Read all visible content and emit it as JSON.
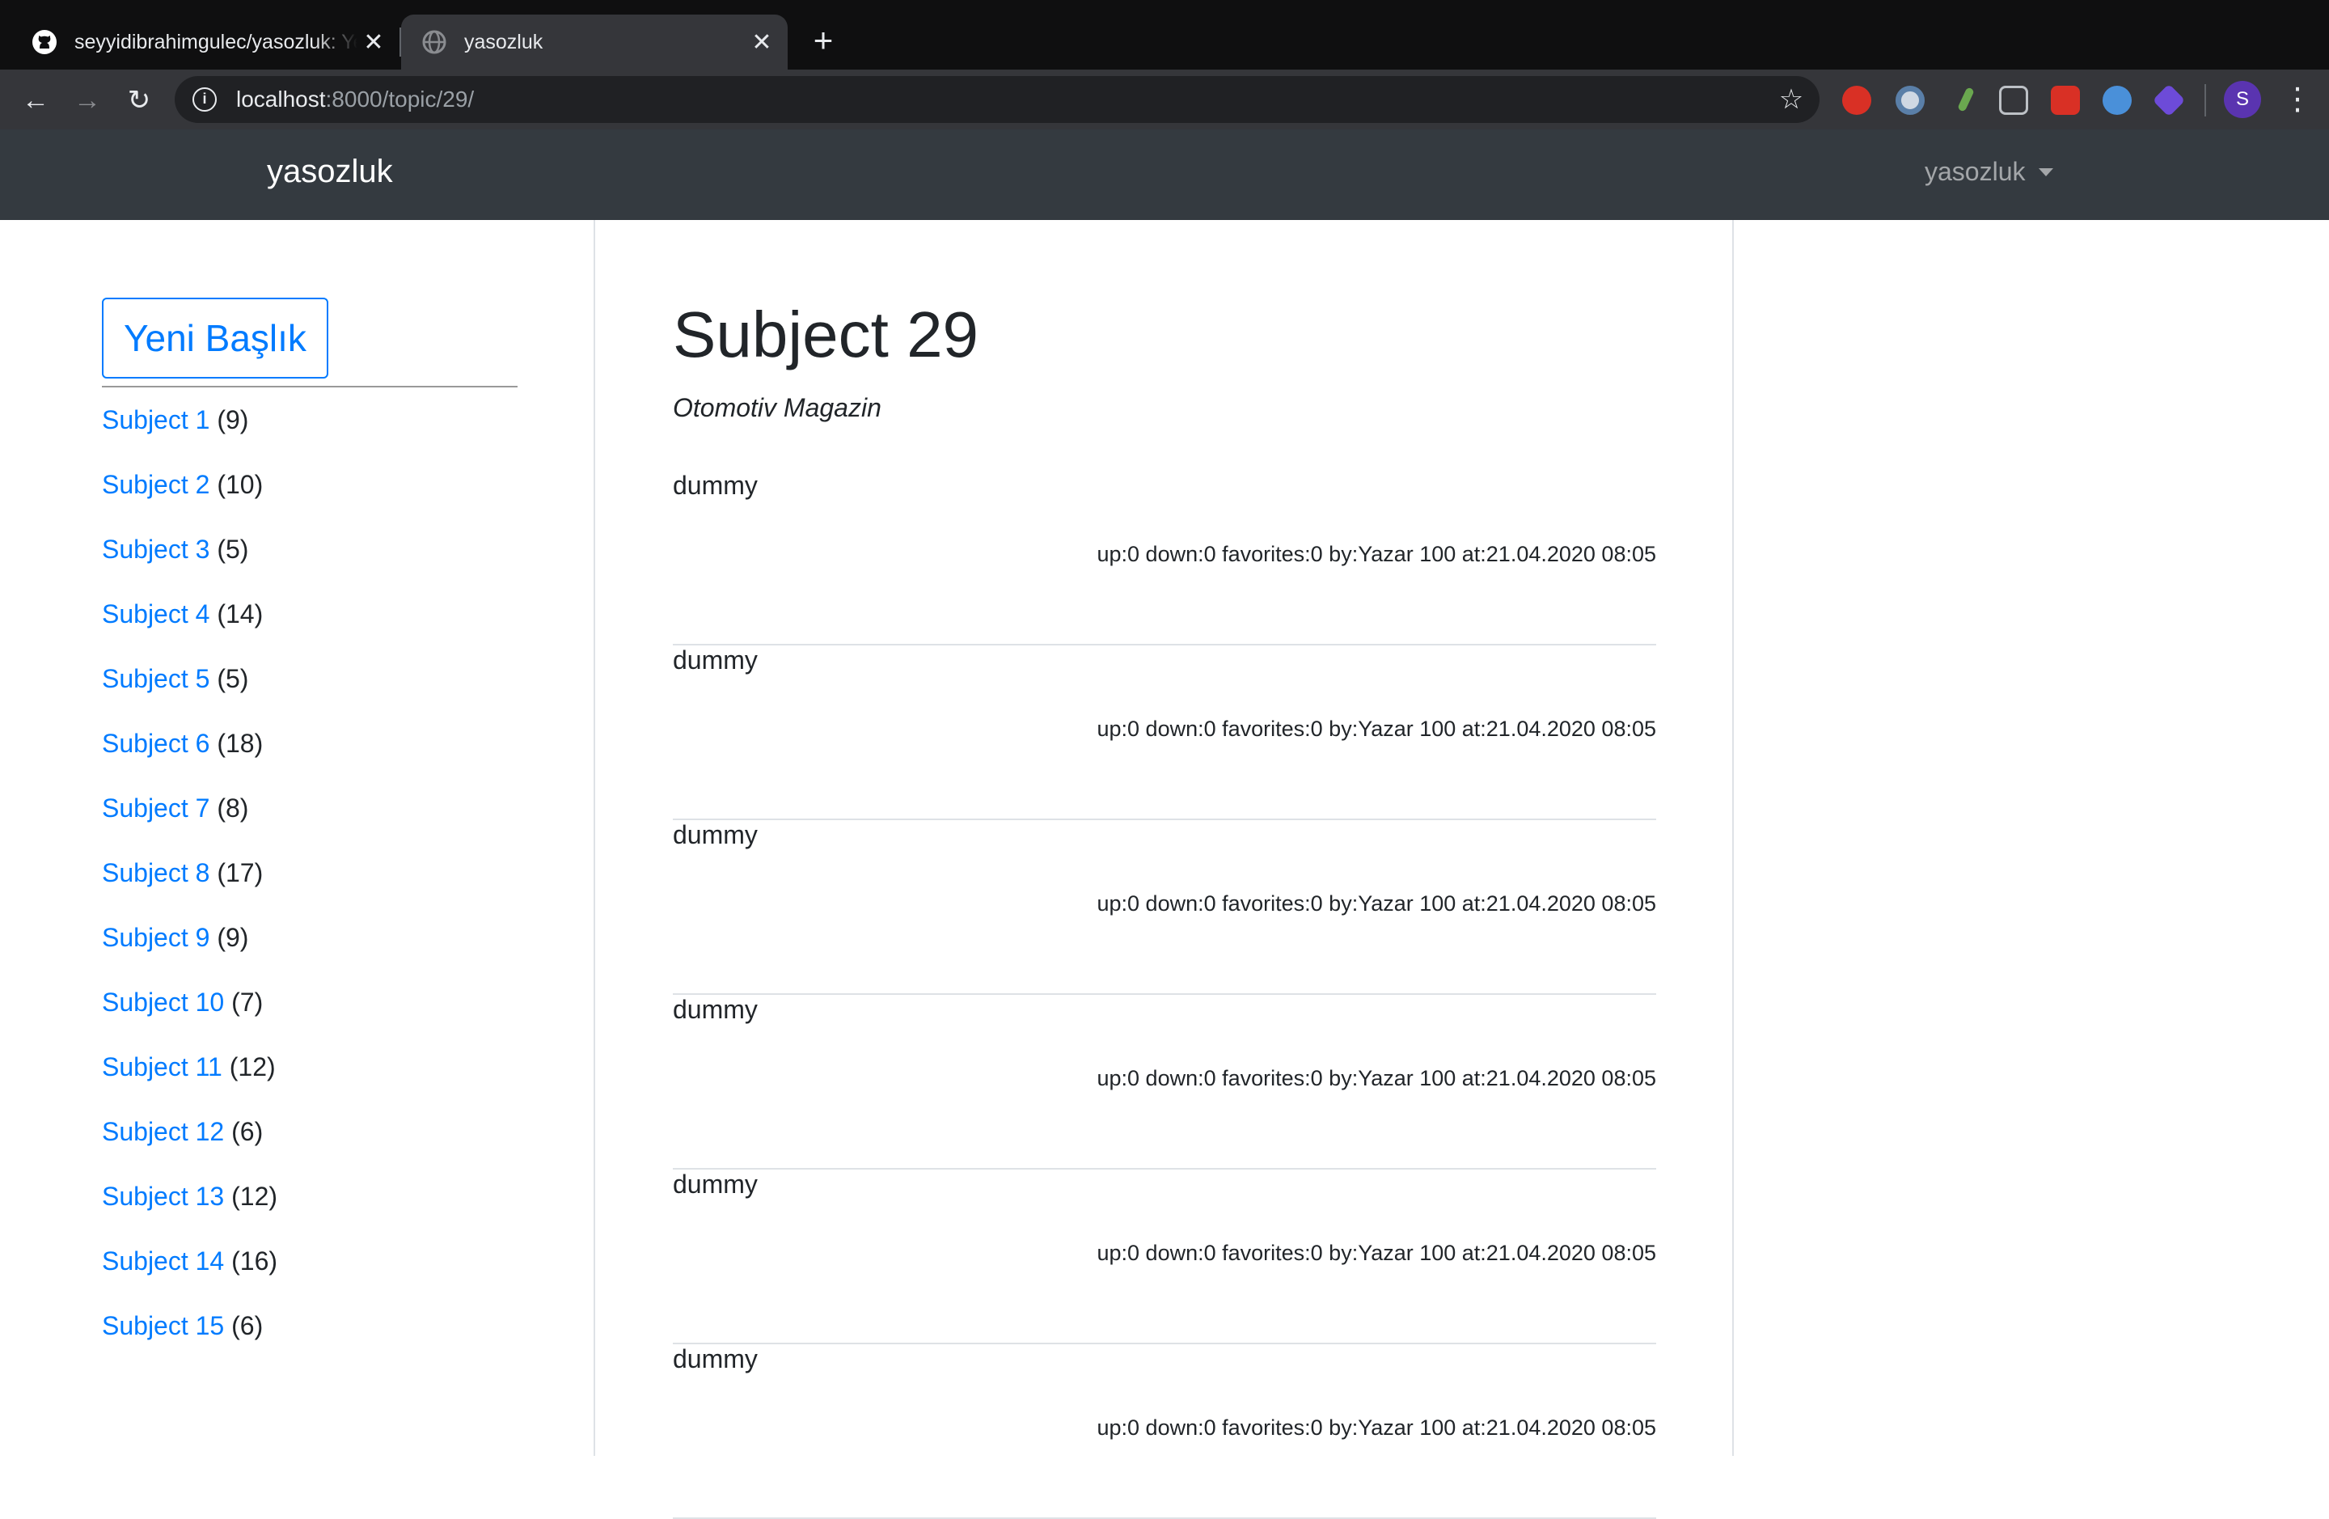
{
  "browser": {
    "tabs": [
      {
        "title": "seyyidibrahimgulec/yasozluk: Ye",
        "icon": "github-icon",
        "active": false
      },
      {
        "title": "yasozluk",
        "icon": "globe-icon",
        "active": true
      }
    ],
    "new_tab": "+",
    "url_host": "localhost",
    "url_rest": ":8000/topic/29/",
    "profile_initial": "S",
    "extensions": [
      "adblock-icon",
      "extension-icon",
      "pin-icon",
      "glasses-icon",
      "video-icon",
      "vimeo-icon",
      "diamond-icon"
    ]
  },
  "navbar": {
    "brand": "yasozluk",
    "user_menu": "yasozluk"
  },
  "sidebar": {
    "new_topic_label": "Yeni Başlık",
    "topics": [
      {
        "name": "Subject 1",
        "count": "(9)"
      },
      {
        "name": "Subject 2",
        "count": "(10)"
      },
      {
        "name": "Subject 3",
        "count": "(5)"
      },
      {
        "name": "Subject 4",
        "count": "(14)"
      },
      {
        "name": "Subject 5",
        "count": "(5)"
      },
      {
        "name": "Subject 6",
        "count": "(18)"
      },
      {
        "name": "Subject 7",
        "count": "(8)"
      },
      {
        "name": "Subject 8",
        "count": "(17)"
      },
      {
        "name": "Subject 9",
        "count": "(9)"
      },
      {
        "name": "Subject 10",
        "count": "(7)"
      },
      {
        "name": "Subject 11",
        "count": "(12)"
      },
      {
        "name": "Subject 12",
        "count": "(6)"
      },
      {
        "name": "Subject 13",
        "count": "(12)"
      },
      {
        "name": "Subject 14",
        "count": "(16)"
      },
      {
        "name": "Subject 15",
        "count": "(6)"
      }
    ]
  },
  "main": {
    "title": "Subject 29",
    "category": "Otomotiv Magazin",
    "entries": [
      {
        "text": "dummy",
        "meta": "up:0 down:0 favorites:0 by:Yazar 100 at:21.04.2020 08:05"
      },
      {
        "text": "dummy",
        "meta": "up:0 down:0 favorites:0 by:Yazar 100 at:21.04.2020 08:05"
      },
      {
        "text": "dummy",
        "meta": "up:0 down:0 favorites:0 by:Yazar 100 at:21.04.2020 08:05"
      },
      {
        "text": "dummy",
        "meta": "up:0 down:0 favorites:0 by:Yazar 100 at:21.04.2020 08:05"
      },
      {
        "text": "dummy",
        "meta": "up:0 down:0 favorites:0 by:Yazar 100 at:21.04.2020 08:05"
      },
      {
        "text": "dummy",
        "meta": "up:0 down:0 favorites:0 by:Yazar 100 at:21.04.2020 08:05"
      }
    ]
  },
  "colors": {
    "link": "#007bff",
    "navbar": "#343a40",
    "text": "#212529"
  }
}
